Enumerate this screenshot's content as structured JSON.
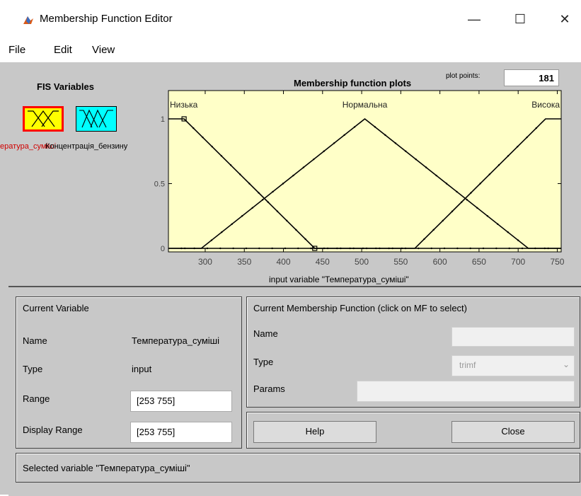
{
  "window": {
    "title": "Membership Function Editor",
    "minimize": "—",
    "maximize": "☐",
    "close": "✕"
  },
  "menu": [
    "File",
    "Edit",
    "View"
  ],
  "fis": {
    "label": "FIS Variables",
    "variables": [
      "Температура_суміші",
      "Концентрація_бензину"
    ],
    "name1_visible": "ература_суміші",
    "name2_visible": "Концентрація_бензину"
  },
  "plot": {
    "title": "Membership function plots",
    "plot_points_label": "plot points:",
    "plot_points": "181",
    "xlabel": "input variable \"Температура_суміші\""
  },
  "chart_data": {
    "type": "line",
    "xlim": [
      253,
      755
    ],
    "ylim": [
      0,
      1
    ],
    "x_ticks": [
      300,
      350,
      400,
      450,
      500,
      550,
      600,
      650,
      700,
      750
    ],
    "y_ticks": [
      0,
      0.5,
      1
    ],
    "y_tick_labels": [
      "0",
      "0.5",
      "1"
    ],
    "background": "#ffffc8",
    "series": [
      {
        "name": "Низька",
        "type": "trapmf",
        "x": [
          253,
          253,
          273,
          440
        ],
        "y": [
          1,
          1,
          1,
          0
        ]
      },
      {
        "name": "Нормальна",
        "type": "trimf",
        "x": [
          295,
          504,
          713
        ],
        "y": [
          0,
          1,
          0
        ]
      },
      {
        "name": "Висока",
        "type": "trapmf",
        "x": [
          568,
          735,
          755,
          755
        ],
        "y": [
          0,
          1,
          1,
          1
        ]
      }
    ]
  },
  "current_variable": {
    "header": "Current Variable",
    "name_label": "Name",
    "name_value": "Температура_суміші",
    "type_label": "Type",
    "type_value": "input",
    "range_label": "Range",
    "range_value": "[253 755]",
    "display_range_label": "Display Range",
    "display_range_value": "[253 755]"
  },
  "current_mf": {
    "header": "Current Membership Function (click on MF to select)",
    "name_label": "Name",
    "name_value": "",
    "type_label": "Type",
    "type_value": "trimf",
    "params_label": "Params",
    "params_value": ""
  },
  "buttons": {
    "help": "Help",
    "close": "Close"
  },
  "status": "Selected variable \"Температура_суміші\""
}
